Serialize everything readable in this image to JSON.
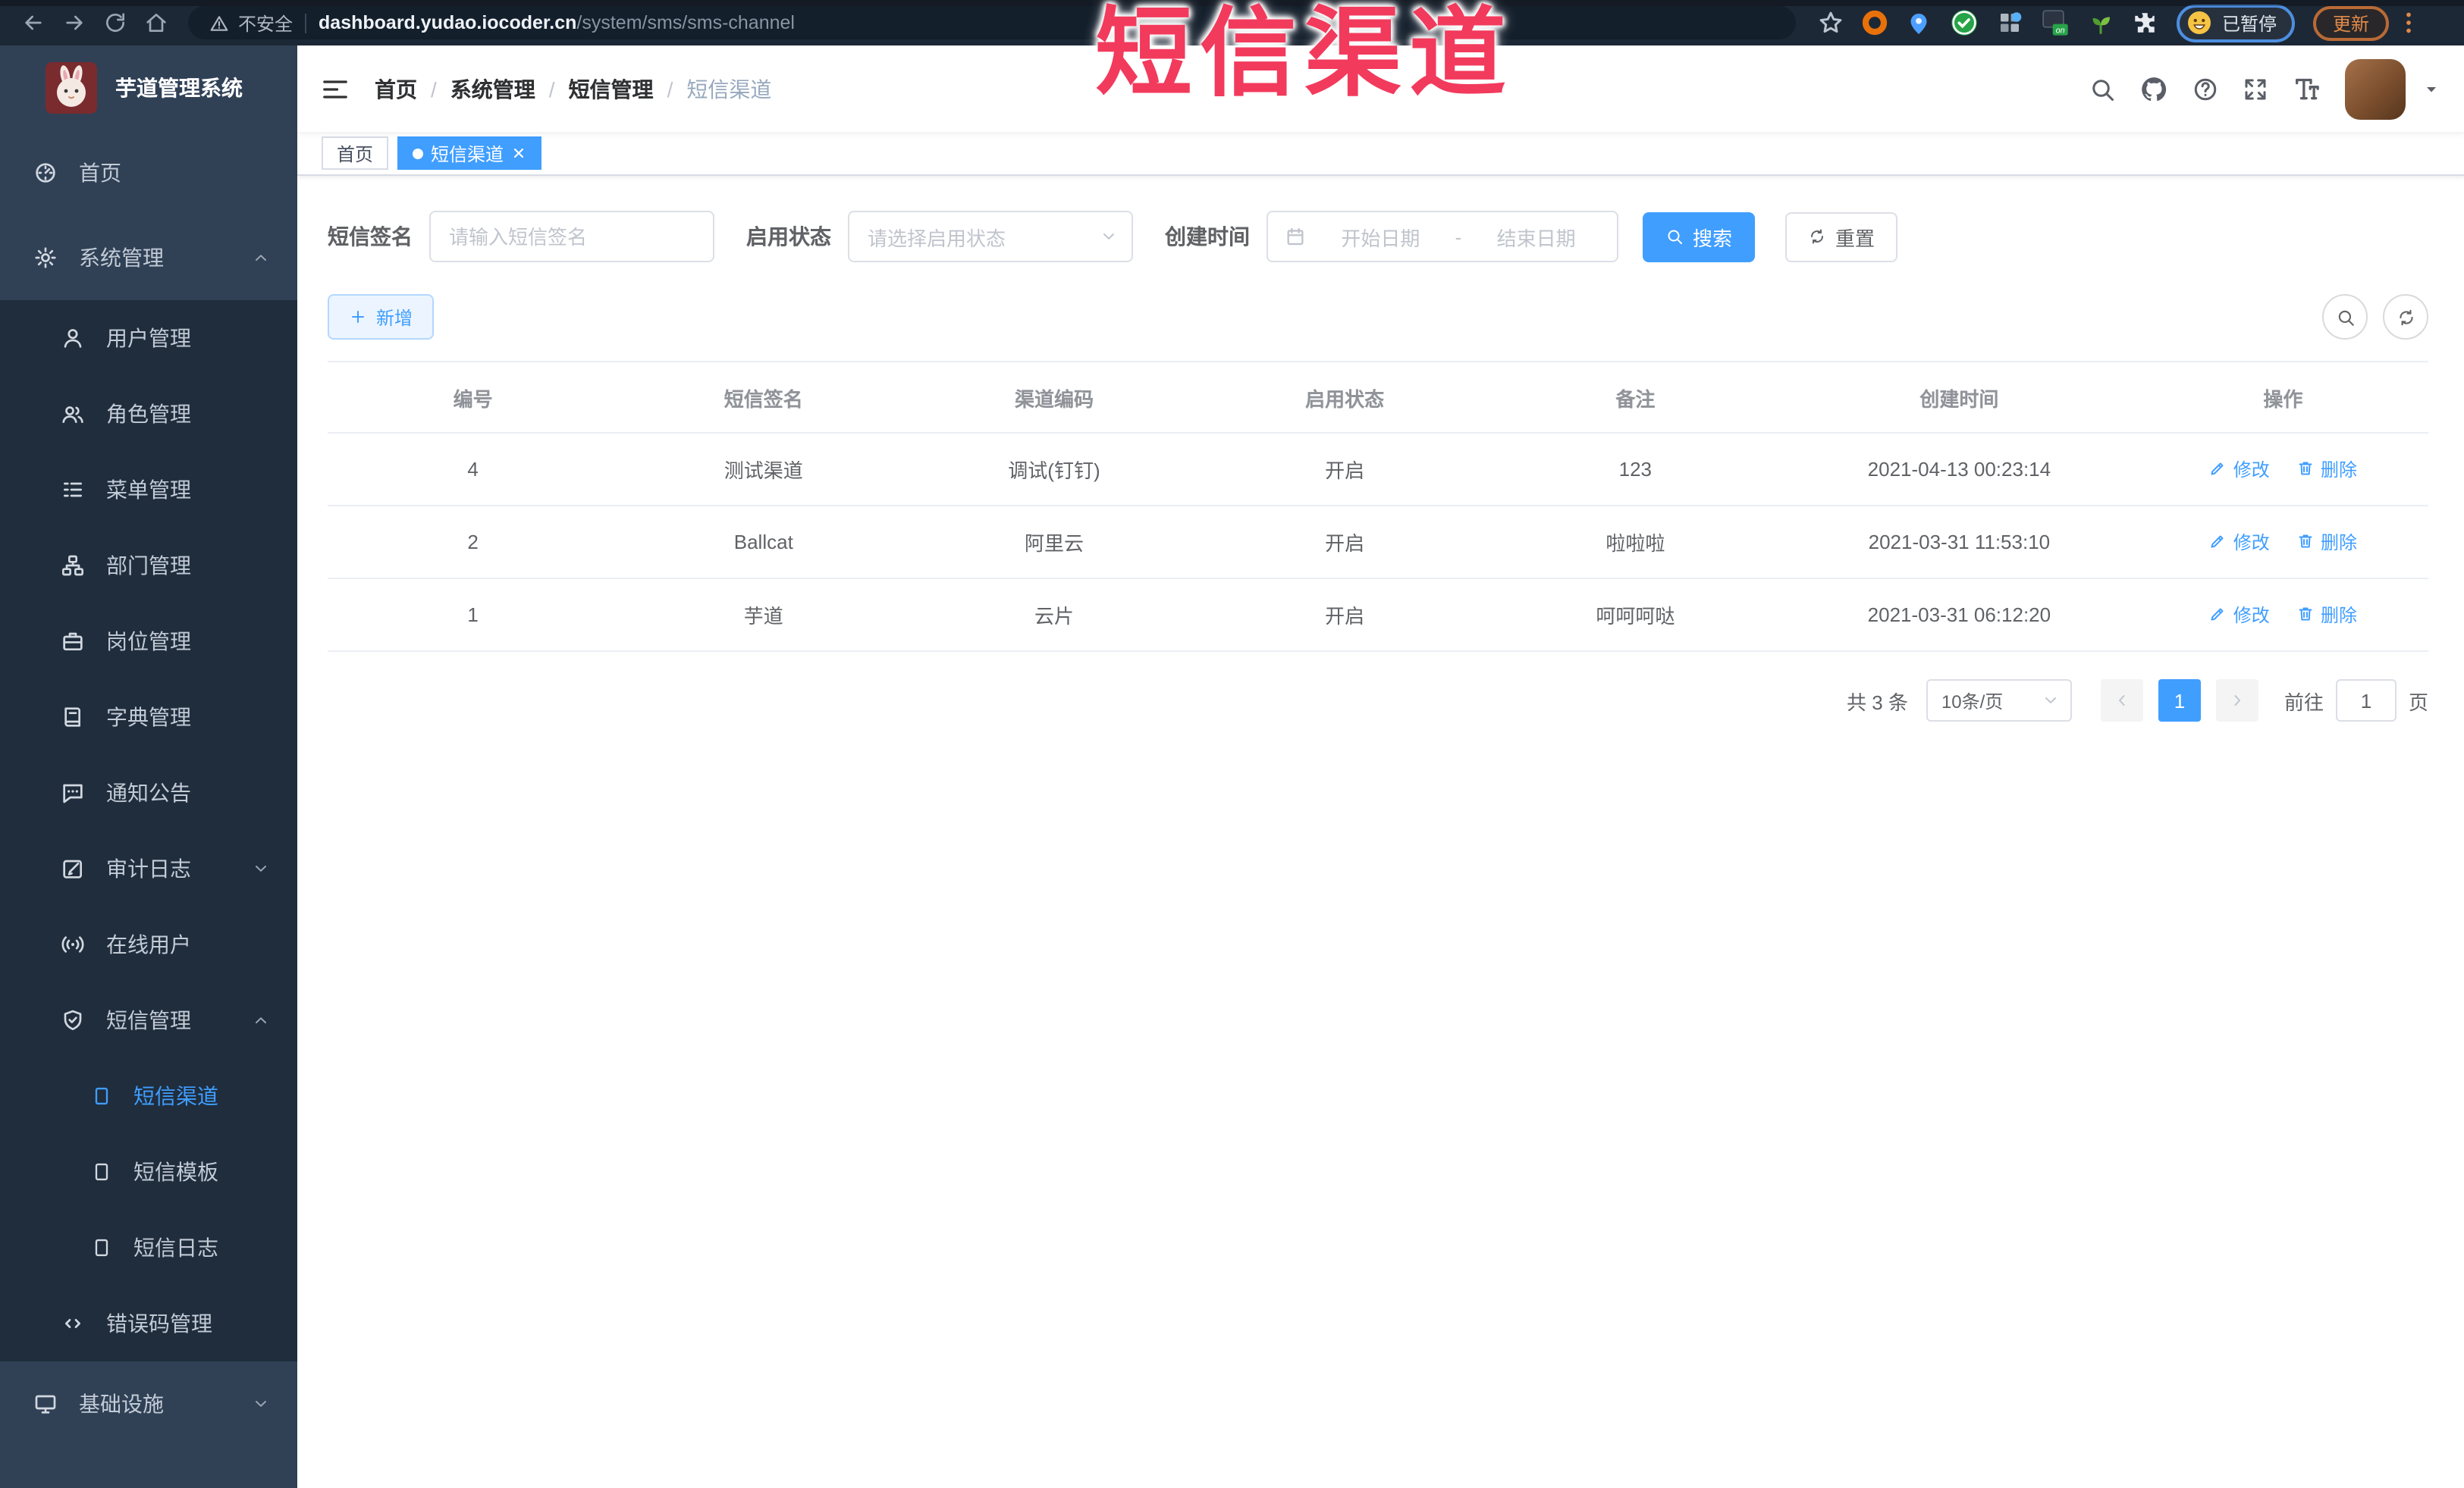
{
  "browser": {
    "security_label": "不安全",
    "url_host": "dashboard.yudao.iocoder.cn",
    "url_path": "/system/sms/sms-channel",
    "profile_status": "已暂停",
    "update_label": "更新"
  },
  "watermark": "短信渠道",
  "sidebar": {
    "logo_title": "芋道管理系统",
    "items": [
      {
        "label": "首页",
        "icon": "dashboard-icon"
      },
      {
        "label": "系统管理",
        "icon": "gear-icon",
        "arrow": "chevron-up-icon"
      },
      {
        "label": "用户管理",
        "icon": "user-icon"
      },
      {
        "label": "角色管理",
        "icon": "users-icon"
      },
      {
        "label": "菜单管理",
        "icon": "list-icon"
      },
      {
        "label": "部门管理",
        "icon": "sitemap-icon"
      },
      {
        "label": "岗位管理",
        "icon": "briefcase-icon"
      },
      {
        "label": "字典管理",
        "icon": "book-icon"
      },
      {
        "label": "通知公告",
        "icon": "comment-icon"
      },
      {
        "label": "审计日志",
        "icon": "edit-square-icon",
        "arrow": "chevron-down-icon"
      },
      {
        "label": "在线用户",
        "icon": "signal-icon"
      },
      {
        "label": "短信管理",
        "icon": "shield-icon",
        "arrow": "chevron-up-icon"
      },
      {
        "label": "短信渠道",
        "icon": "doc-icon",
        "active": true
      },
      {
        "label": "短信模板",
        "icon": "doc-icon"
      },
      {
        "label": "短信日志",
        "icon": "doc-icon"
      },
      {
        "label": "错误码管理",
        "icon": "code-icon"
      },
      {
        "label": "基础设施",
        "icon": "monitor-icon",
        "arrow": "chevron-down-icon"
      }
    ]
  },
  "navbar": {
    "separator": "/",
    "breadcrumb": [
      "首页",
      "系统管理",
      "短信管理",
      "短信渠道"
    ]
  },
  "tabs": [
    {
      "label": "首页"
    },
    {
      "label": "短信渠道"
    }
  ],
  "filters": {
    "sign_label": "短信签名",
    "sign_placeholder": "请输入短信签名",
    "status_label": "启用状态",
    "status_placeholder": "请选择启用状态",
    "time_label": "创建时间",
    "start_placeholder": "开始日期",
    "range_separator": "-",
    "end_placeholder": "结束日期",
    "search_button": "搜索",
    "reset_button": "重置"
  },
  "toolbar": {
    "add_button": "新增"
  },
  "table": {
    "columns": [
      "编号",
      "短信签名",
      "渠道编码",
      "启用状态",
      "备注",
      "创建时间",
      "操作"
    ],
    "rows": [
      {
        "id": "4",
        "sign": "测试渠道",
        "code": "调试(钉钉)",
        "status": "开启",
        "remark": "123",
        "created": "2021-04-13 00:23:14",
        "edit": "修改",
        "delete": "删除"
      },
      {
        "id": "2",
        "sign": "Ballcat",
        "code": "阿里云",
        "status": "开启",
        "remark": "啦啦啦",
        "created": "2021-03-31 11:53:10",
        "edit": "修改",
        "delete": "删除"
      },
      {
        "id": "1",
        "sign": "芋道",
        "code": "云片",
        "status": "开启",
        "remark": "呵呵呵哒",
        "created": "2021-03-31 06:12:20",
        "edit": "修改",
        "delete": "删除"
      }
    ]
  },
  "pagination": {
    "total": "共 3 条",
    "page_size": "10条/页",
    "current_page": "1",
    "goto_label": "前往",
    "goto_value": "1",
    "page_unit": "页"
  },
  "colors": {
    "primary": "#409EFF",
    "sidebar_bg": "#304156",
    "submenu_bg": "#1F2D3D",
    "watermark": "#F23A5C",
    "browser_bar": "#1D2836"
  }
}
